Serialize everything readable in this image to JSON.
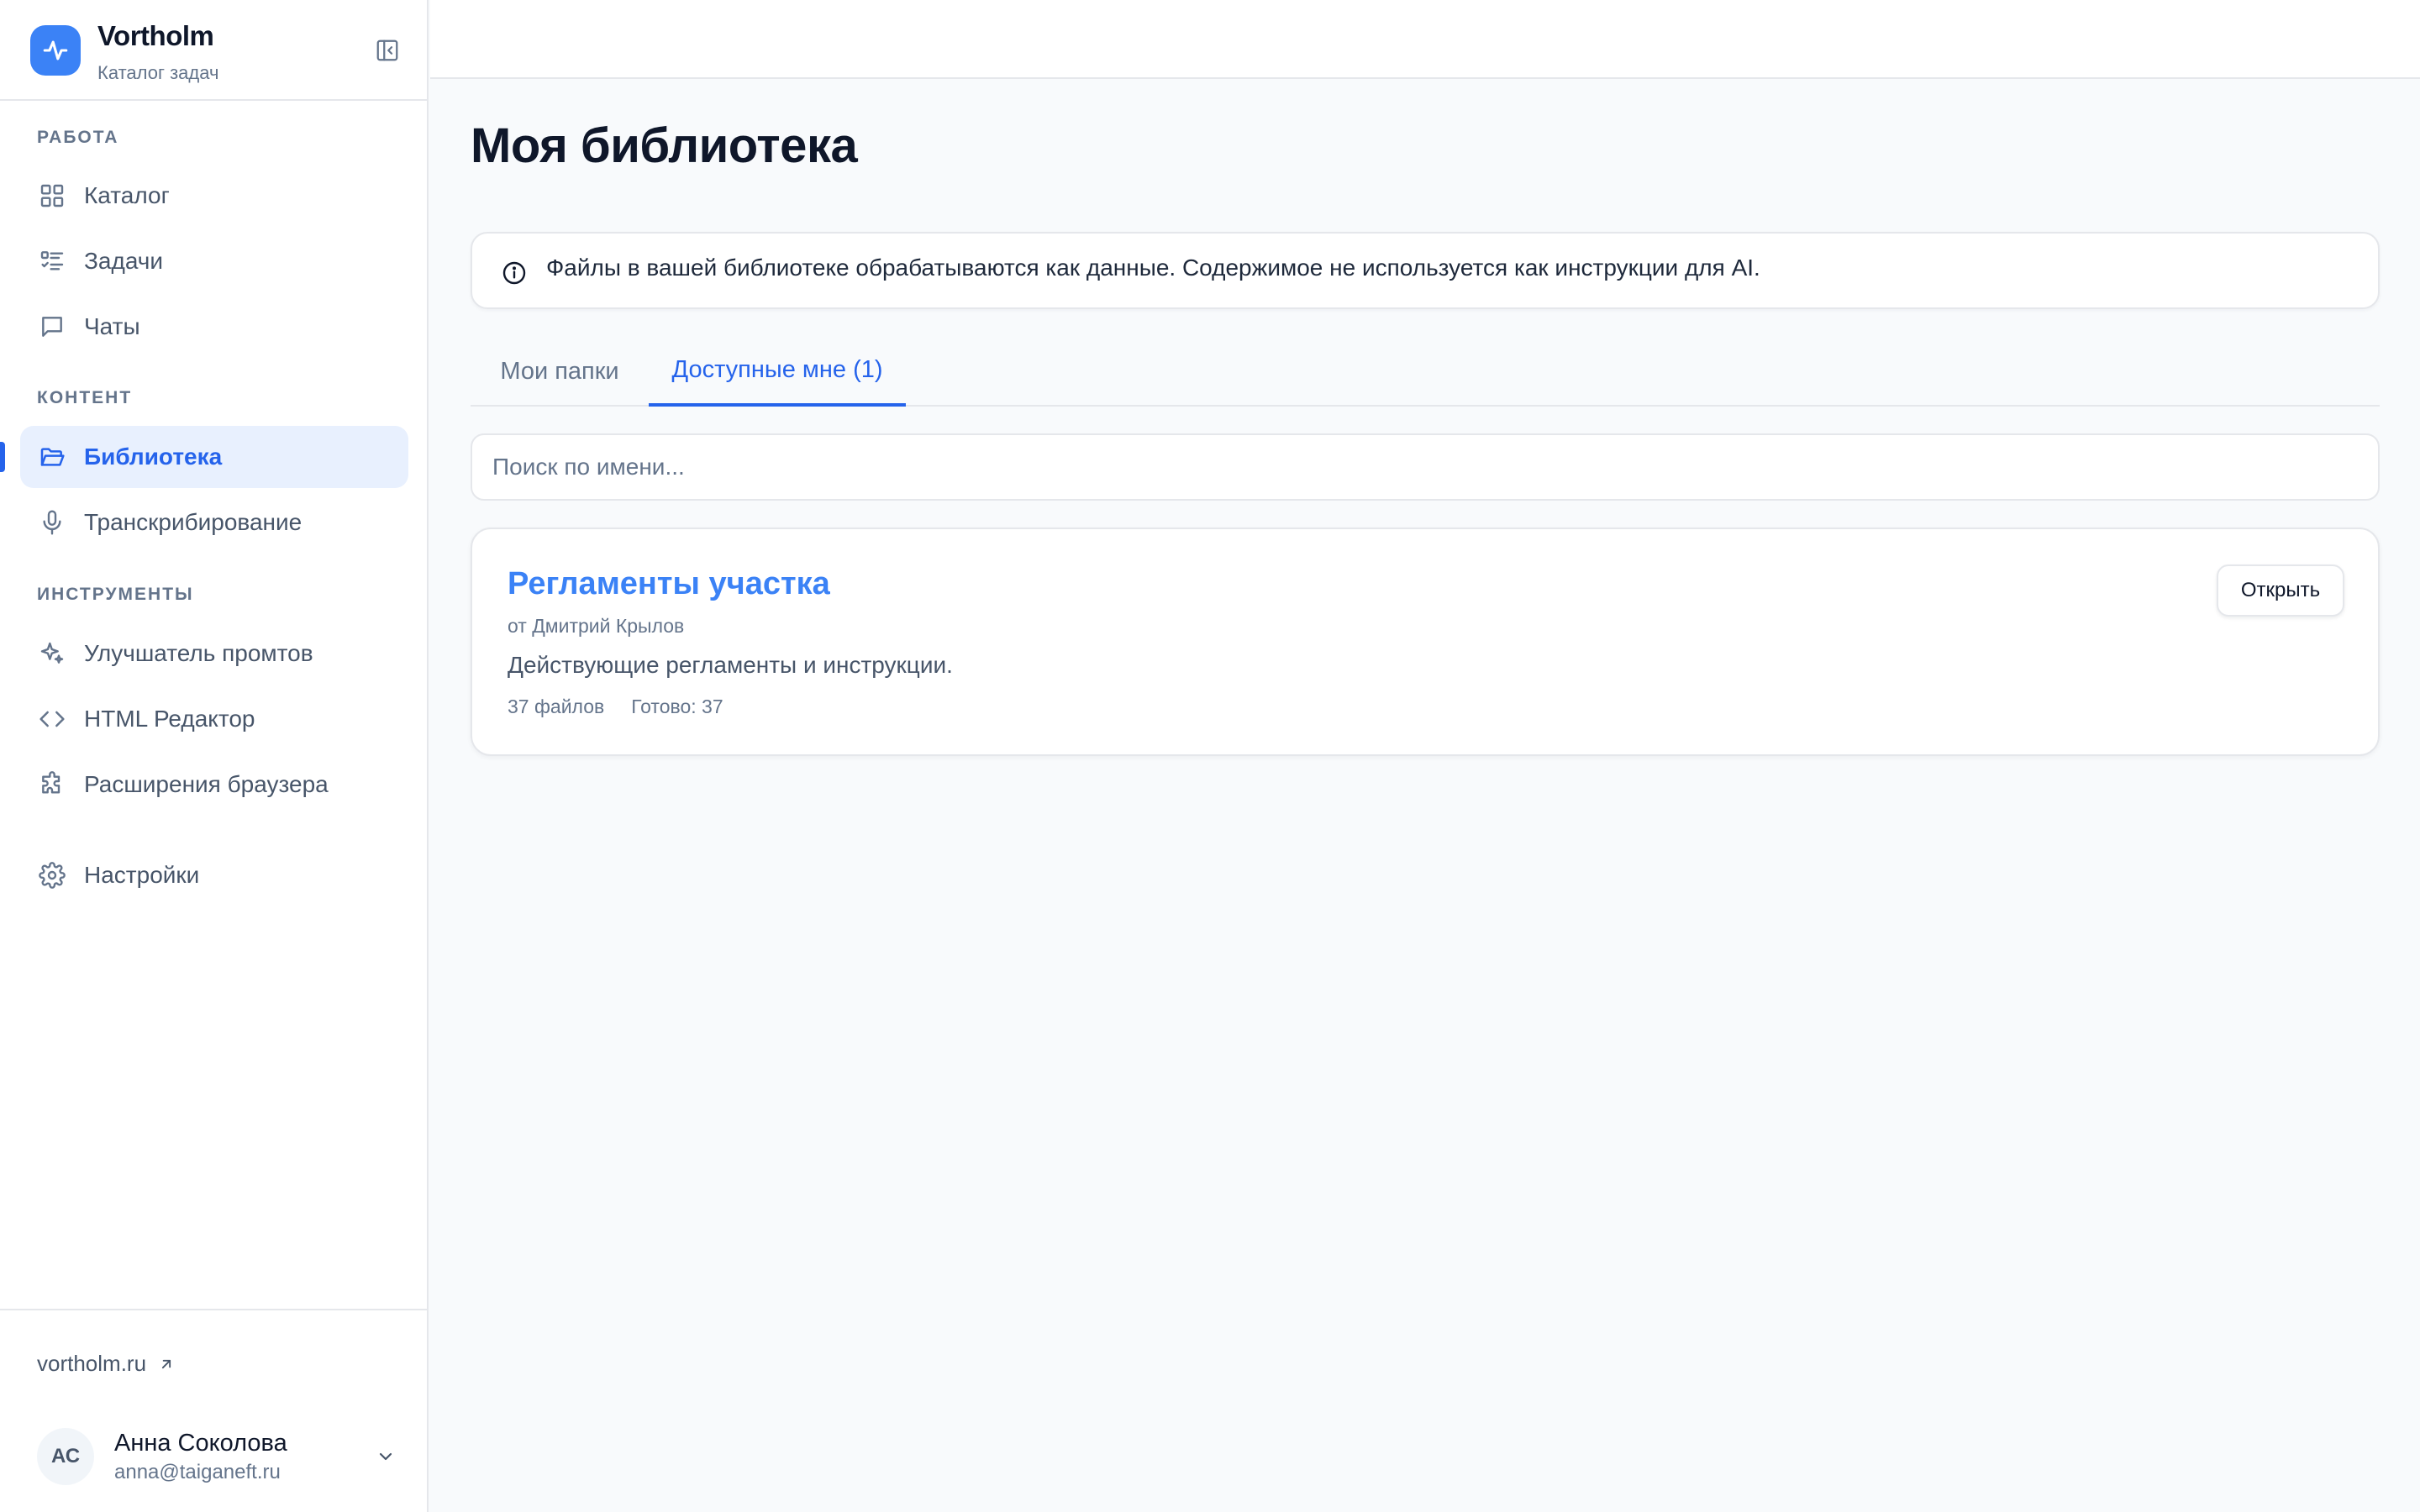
{
  "brand": {
    "name": "Vortholm",
    "subtitle": "Каталог задач",
    "accent": "#3b82f6"
  },
  "sidebar": {
    "sections": [
      {
        "label": "РАБОТА",
        "items": [
          {
            "label": "Каталог",
            "icon": "grid-icon"
          },
          {
            "label": "Задачи",
            "icon": "task-list-icon"
          },
          {
            "label": "Чаты",
            "icon": "chat-icon"
          }
        ]
      },
      {
        "label": "КОНТЕНТ",
        "items": [
          {
            "label": "Библиотека",
            "icon": "folder-open-icon",
            "active": true
          },
          {
            "label": "Транскрибирование",
            "icon": "microphone-icon"
          }
        ]
      },
      {
        "label": "ИНСТРУМЕНТЫ",
        "items": [
          {
            "label": "Улучшатель промтов",
            "icon": "sparkles-icon"
          },
          {
            "label": "HTML Редактор",
            "icon": "code-icon"
          },
          {
            "label": "Расширения браузера",
            "icon": "puzzle-icon"
          }
        ]
      }
    ],
    "settings": {
      "label": "Настройки",
      "icon": "gear-icon"
    },
    "footer": {
      "site_link": "vortholm.ru",
      "user": {
        "initials": "АС",
        "name": "Анна Соколова",
        "email": "anna@taiganeft.ru"
      }
    }
  },
  "main": {
    "title": "Моя библиотека",
    "notice": "Файлы в вашей библиотеке обрабатываются как данные. Содержимое не используется как инструкции для AI.",
    "tabs": [
      {
        "label": "Мои папки",
        "active": false
      },
      {
        "label": "Доступные мне (1)",
        "active": true
      }
    ],
    "search": {
      "placeholder": "Поиск по имени...",
      "value": ""
    },
    "folders": [
      {
        "title": "Регламенты участка",
        "author": "от Дмитрий Крылов",
        "description": "Действующие регламенты и инструкции.",
        "files": "37 файлов",
        "ready": "Готово: 37",
        "open_label": "Открыть"
      }
    ]
  }
}
